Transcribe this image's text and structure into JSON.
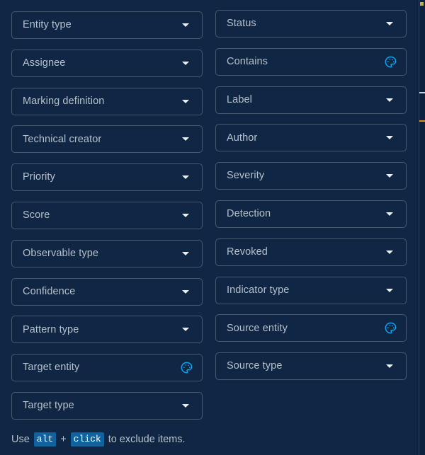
{
  "panel": {
    "background_color": "#0f2744",
    "outer_background_color": "#0c2340",
    "border_color": "#455a70",
    "label_color": "#b6c0cb",
    "accent_color": "#0fa2ef",
    "kbd_background_color": "#11639f"
  },
  "fields": [
    {
      "label": "Entity type",
      "control": "chevron-down-icon",
      "column": "left",
      "row": 0
    },
    {
      "label": "Status",
      "control": "chevron-down-icon",
      "column": "right",
      "row": 0
    },
    {
      "label": "Assignee",
      "control": "chevron-down-icon",
      "column": "left",
      "row": 1
    },
    {
      "label": "Contains",
      "control": "palette-icon",
      "column": "right",
      "row": 1
    },
    {
      "label": "Marking definition",
      "control": "chevron-down-icon",
      "column": "left",
      "row": 2
    },
    {
      "label": "Label",
      "control": "chevron-down-icon",
      "column": "right",
      "row": 2
    },
    {
      "label": "Technical creator",
      "control": "chevron-down-icon",
      "column": "left",
      "row": 3
    },
    {
      "label": "Author",
      "control": "chevron-down-icon",
      "column": "right",
      "row": 3
    },
    {
      "label": "Priority",
      "control": "chevron-down-icon",
      "column": "left",
      "row": 4
    },
    {
      "label": "Severity",
      "control": "chevron-down-icon",
      "column": "right",
      "row": 4
    },
    {
      "label": "Score",
      "control": "chevron-down-icon",
      "column": "left",
      "row": 5
    },
    {
      "label": "Detection",
      "control": "chevron-down-icon",
      "column": "right",
      "row": 5
    },
    {
      "label": "Observable type",
      "control": "chevron-down-icon",
      "column": "left",
      "row": 6
    },
    {
      "label": "Revoked",
      "control": "chevron-down-icon",
      "column": "right",
      "row": 6
    },
    {
      "label": "Confidence",
      "control": "chevron-down-icon",
      "column": "left",
      "row": 7
    },
    {
      "label": "Indicator type",
      "control": "chevron-down-icon",
      "column": "right",
      "row": 7
    },
    {
      "label": "Pattern type",
      "control": "chevron-down-icon",
      "column": "left",
      "row": 8
    },
    {
      "label": "Source entity",
      "control": "palette-icon",
      "column": "right",
      "row": 8
    },
    {
      "label": "Target entity",
      "control": "palette-icon",
      "column": "left",
      "row": 9
    },
    {
      "label": "Source type",
      "control": "chevron-down-icon",
      "column": "right",
      "row": 9
    },
    {
      "label": "Target type",
      "control": "chevron-down-icon",
      "column": "left",
      "row": 10
    }
  ],
  "footer": {
    "prefix": "Use",
    "key_modifier": "alt",
    "separator": "+",
    "key_action": "click",
    "suffix": "to exclude items."
  }
}
